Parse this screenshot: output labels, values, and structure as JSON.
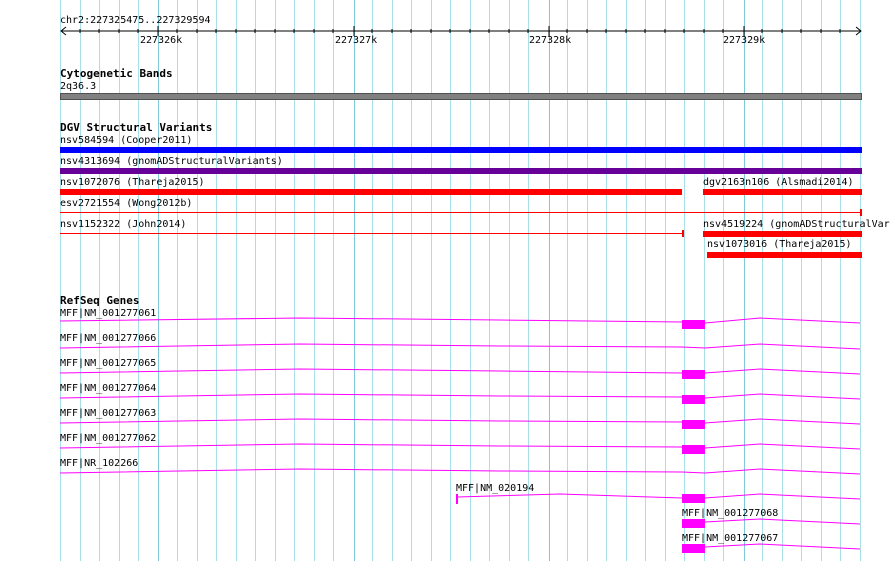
{
  "ruler": {
    "location": "chr2:227325475..227329594",
    "ticks": [
      "227326k",
      "227327k",
      "227328k",
      "227329k"
    ]
  },
  "tracks": {
    "cytoband": {
      "title": "Cytogenetic Bands",
      "band_label": "2q36.3",
      "color": "#808080"
    },
    "dgv": {
      "title": "DGV Structural Variants",
      "variants": [
        {
          "label": "nsv584594 (Cooper2011)",
          "color": "#0000ff"
        },
        {
          "label": "nsv4313694 (gnomADStructuralVariants)",
          "color": "#660099"
        },
        {
          "label": "nsv1072076 (Thareja2015)",
          "color": "#ff0000"
        },
        {
          "label": "dgv2163n106 (Alsmadi2014)",
          "color": "#ff0000"
        },
        {
          "label": "esv2721554 (Wong2012b)",
          "color": "#ff0000"
        },
        {
          "label": "nsv1152322 (John2014)",
          "color": "#ff0000"
        },
        {
          "label": "nsv4519224 (gnomADStructuralVar",
          "color": "#ff0000"
        },
        {
          "label": "nsv1073016 (Thareja2015)",
          "color": "#ff0000"
        }
      ]
    },
    "refseq": {
      "title": "RefSeq Genes",
      "color": "#ff00ff",
      "genes": [
        {
          "label": "MFF|NM_001277061"
        },
        {
          "label": "MFF|NM_001277066"
        },
        {
          "label": "MFF|NM_001277065"
        },
        {
          "label": "MFF|NM_001277064"
        },
        {
          "label": "MFF|NM_001277063"
        },
        {
          "label": "MFF|NM_001277062"
        },
        {
          "label": "MFF|NR_102266"
        },
        {
          "label": "MFF|NM_020194"
        },
        {
          "label": "MFF|NM_001277068"
        },
        {
          "label": "MFF|NM_001277067"
        }
      ]
    }
  }
}
